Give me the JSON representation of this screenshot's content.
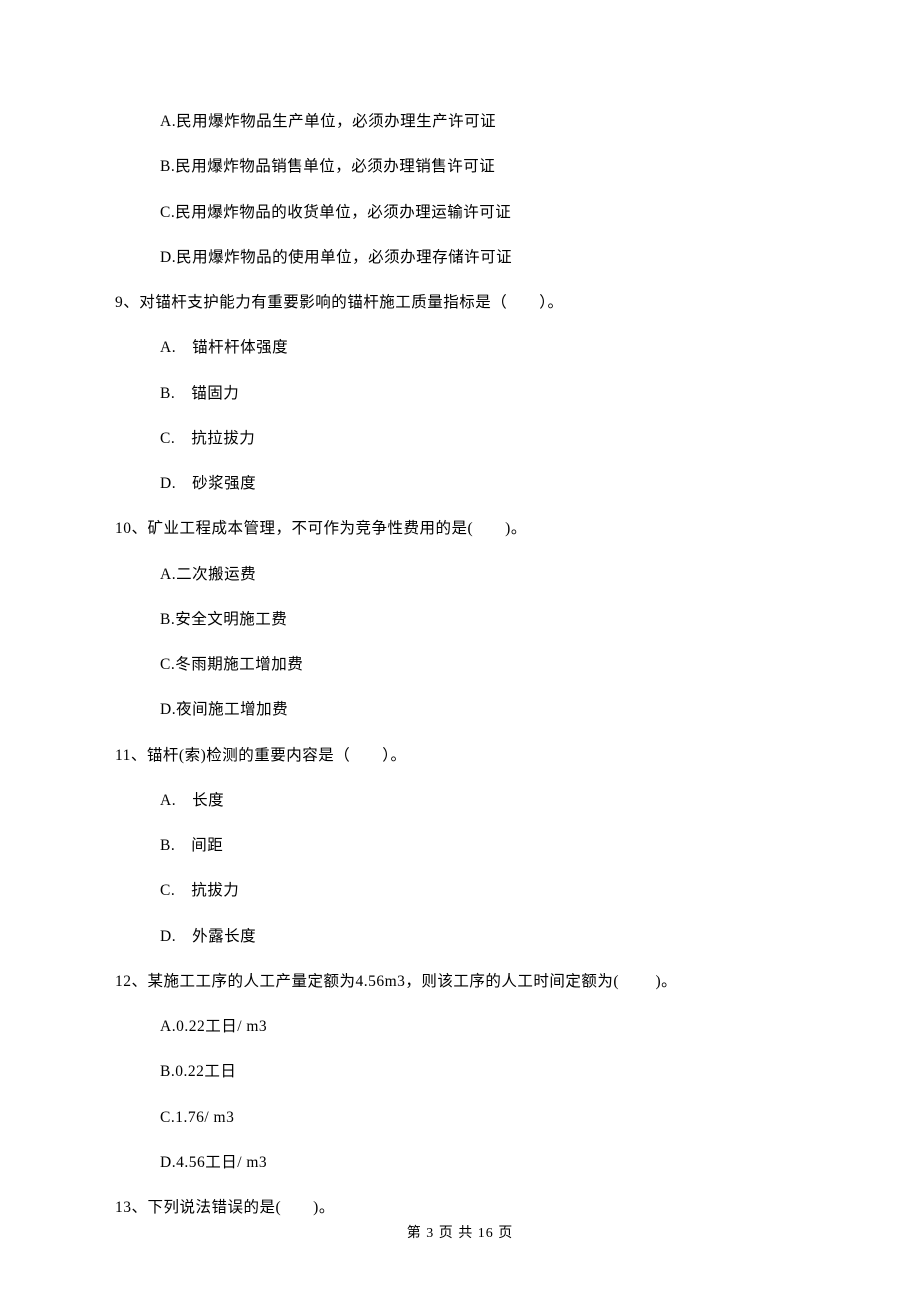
{
  "q8": {
    "options": {
      "a": "A.民用爆炸物品生产单位，必须办理生产许可证",
      "b": "B.民用爆炸物品销售单位，必须办理销售许可证",
      "c": "C.民用爆炸物品的收货单位，必须办理运输许可证",
      "d": "D.民用爆炸物品的使用单位，必须办理存储许可证"
    }
  },
  "q9": {
    "text": "9、对锚杆支护能力有重要影响的锚杆施工质量指标是（　　）。",
    "options": {
      "a": "A.　锚杆杆体强度",
      "b": "B.　锚固力",
      "c": "C.　抗拉拔力",
      "d": "D.　砂浆强度"
    }
  },
  "q10": {
    "text": "10、矿业工程成本管理，不可作为竞争性费用的是(　　)。",
    "options": {
      "a": "A.二次搬运费",
      "b": "B.安全文明施工费",
      "c": "C.冬雨期施工增加费",
      "d": "D.夜间施工增加费"
    }
  },
  "q11": {
    "text": "11、锚杆(索)检测的重要内容是（　　）。",
    "options": {
      "a": "A.　长度",
      "b": "B.　间距",
      "c": "C.　抗拔力",
      "d": "D.　外露长度"
    }
  },
  "q12": {
    "text": "12、某施工工序的人工产量定额为4.56m3，则该工序的人工时间定额为(　　 )。",
    "options": {
      "a": "A.0.22工日/ m3",
      "b": "B.0.22工日",
      "c": "C.1.76/ m3",
      "d": "D.4.56工日/ m3"
    }
  },
  "q13": {
    "text": "13、下列说法错误的是(　　)。"
  },
  "footer": "第 3 页 共 16 页"
}
